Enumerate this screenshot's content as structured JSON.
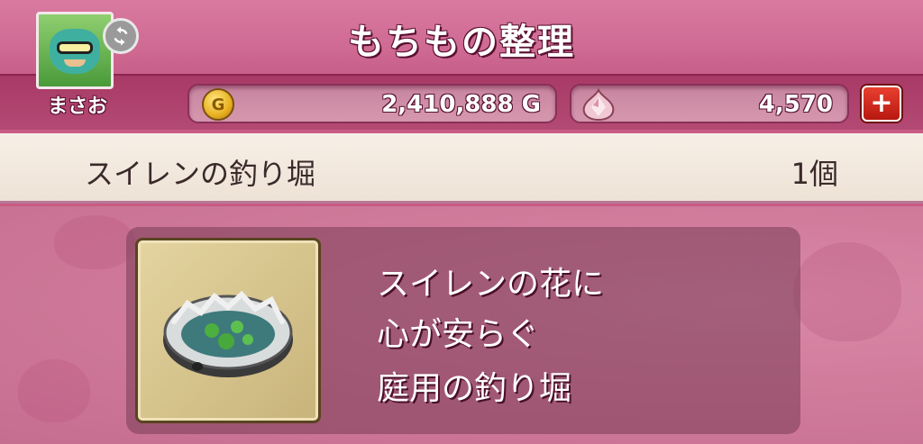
{
  "screen": {
    "title": "もちもの整理"
  },
  "player": {
    "name": "まさお",
    "refresh_icon": "refresh-icon"
  },
  "currency": {
    "gold": "2,410,888 G",
    "gems": "4,570",
    "add_label": "+",
    "coin_symbol": "G"
  },
  "item": {
    "name": "スイレンの釣り堀",
    "count": "1個",
    "description": [
      "スイレンの花に",
      "心が安らぐ",
      "庭用の釣り堀"
    ]
  },
  "colors": {
    "header": "#cf6a93",
    "band": "#a83a66",
    "item_bar": "#f7efe6",
    "panel": "#7a3c55"
  }
}
